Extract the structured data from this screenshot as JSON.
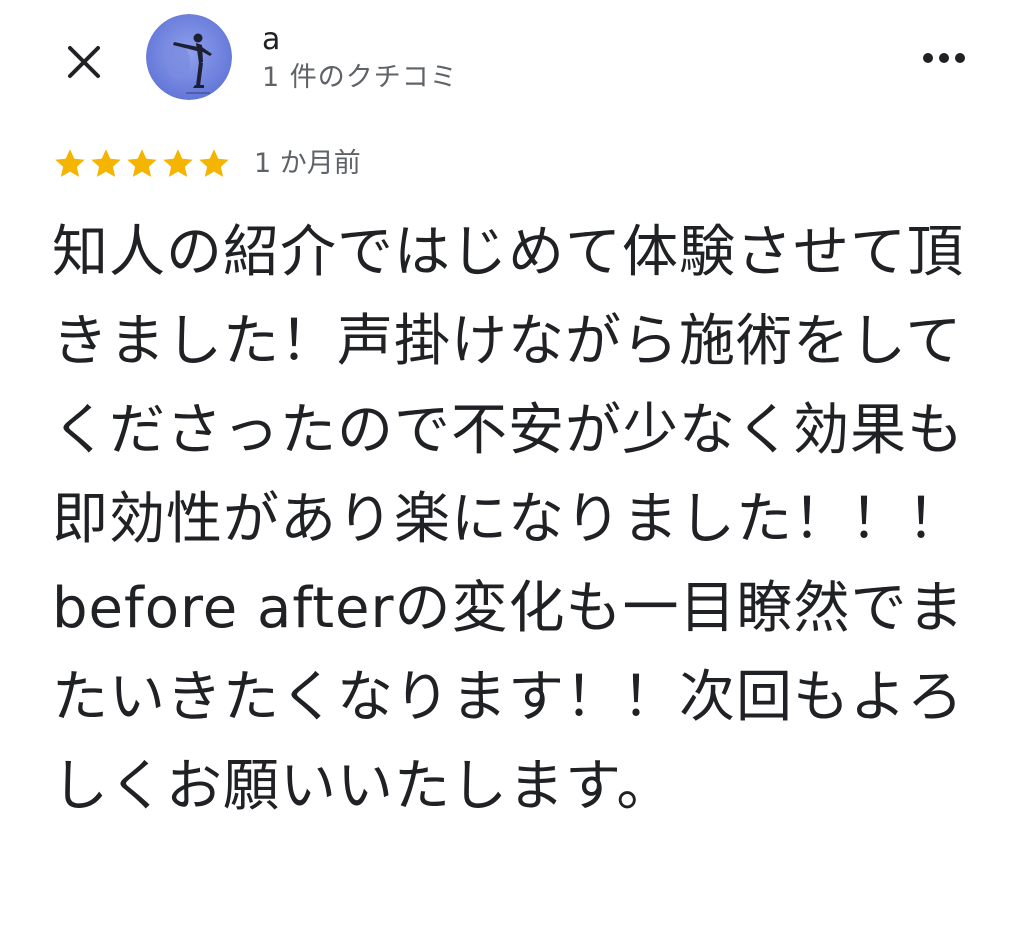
{
  "header": {
    "close_icon": "close-icon",
    "reviewer_name": "a",
    "review_count": "1 件のクチコミ",
    "more_icon": "more-horiz-icon"
  },
  "review": {
    "rating": 5,
    "rating_max": 5,
    "star_color": "#f4b400",
    "date": "1 か月前",
    "text": "知人の紹介ではじめて体験させて頂きました！声掛けながら施術をしてくださったので不安が少なく効果も即効性があり楽になりました！！！before afterの変化も一目瞭然でまたいきたくなります！！次回もよろしくお願いいたします。"
  }
}
